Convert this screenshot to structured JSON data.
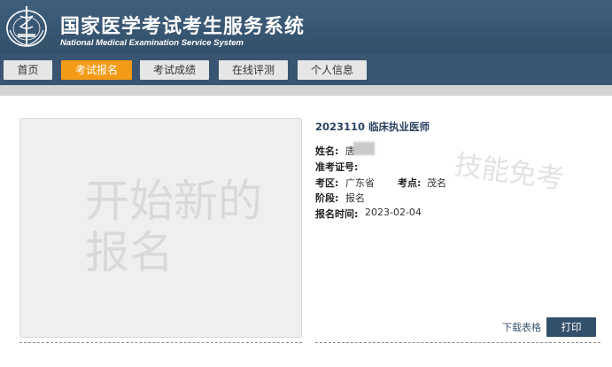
{
  "header": {
    "title": "国家医学考试考生服务系统",
    "subtitle": "National Medical Examination Service System"
  },
  "nav": {
    "items": [
      {
        "label": "首页",
        "active": false
      },
      {
        "label": "考试报名",
        "active": true
      },
      {
        "label": "考试成绩",
        "active": false
      },
      {
        "label": "在线评测",
        "active": false
      },
      {
        "label": "个人信息",
        "active": false
      }
    ]
  },
  "colors": {
    "header_bg": "#3f5f7d",
    "nav_bg": "#3a5571",
    "active_tab": "#f39b18",
    "print_button": "#33506a"
  },
  "new_registration": {
    "label": "开始新的报名"
  },
  "exam_card": {
    "title": "2023110 临床执业医师",
    "name_label": "姓名:",
    "name_value": "唐",
    "admission_label": "准考证号:",
    "region_label": "考区:",
    "region_value": "广东省",
    "site_label": "考点:",
    "site_value": "茂名",
    "stage_label": "阶段:",
    "stage_value": "报名",
    "time_label": "报名时间:",
    "time_value": "2023-02-04",
    "watermark": "技能免考",
    "download_label": "下载表格",
    "print_label": "打印"
  }
}
